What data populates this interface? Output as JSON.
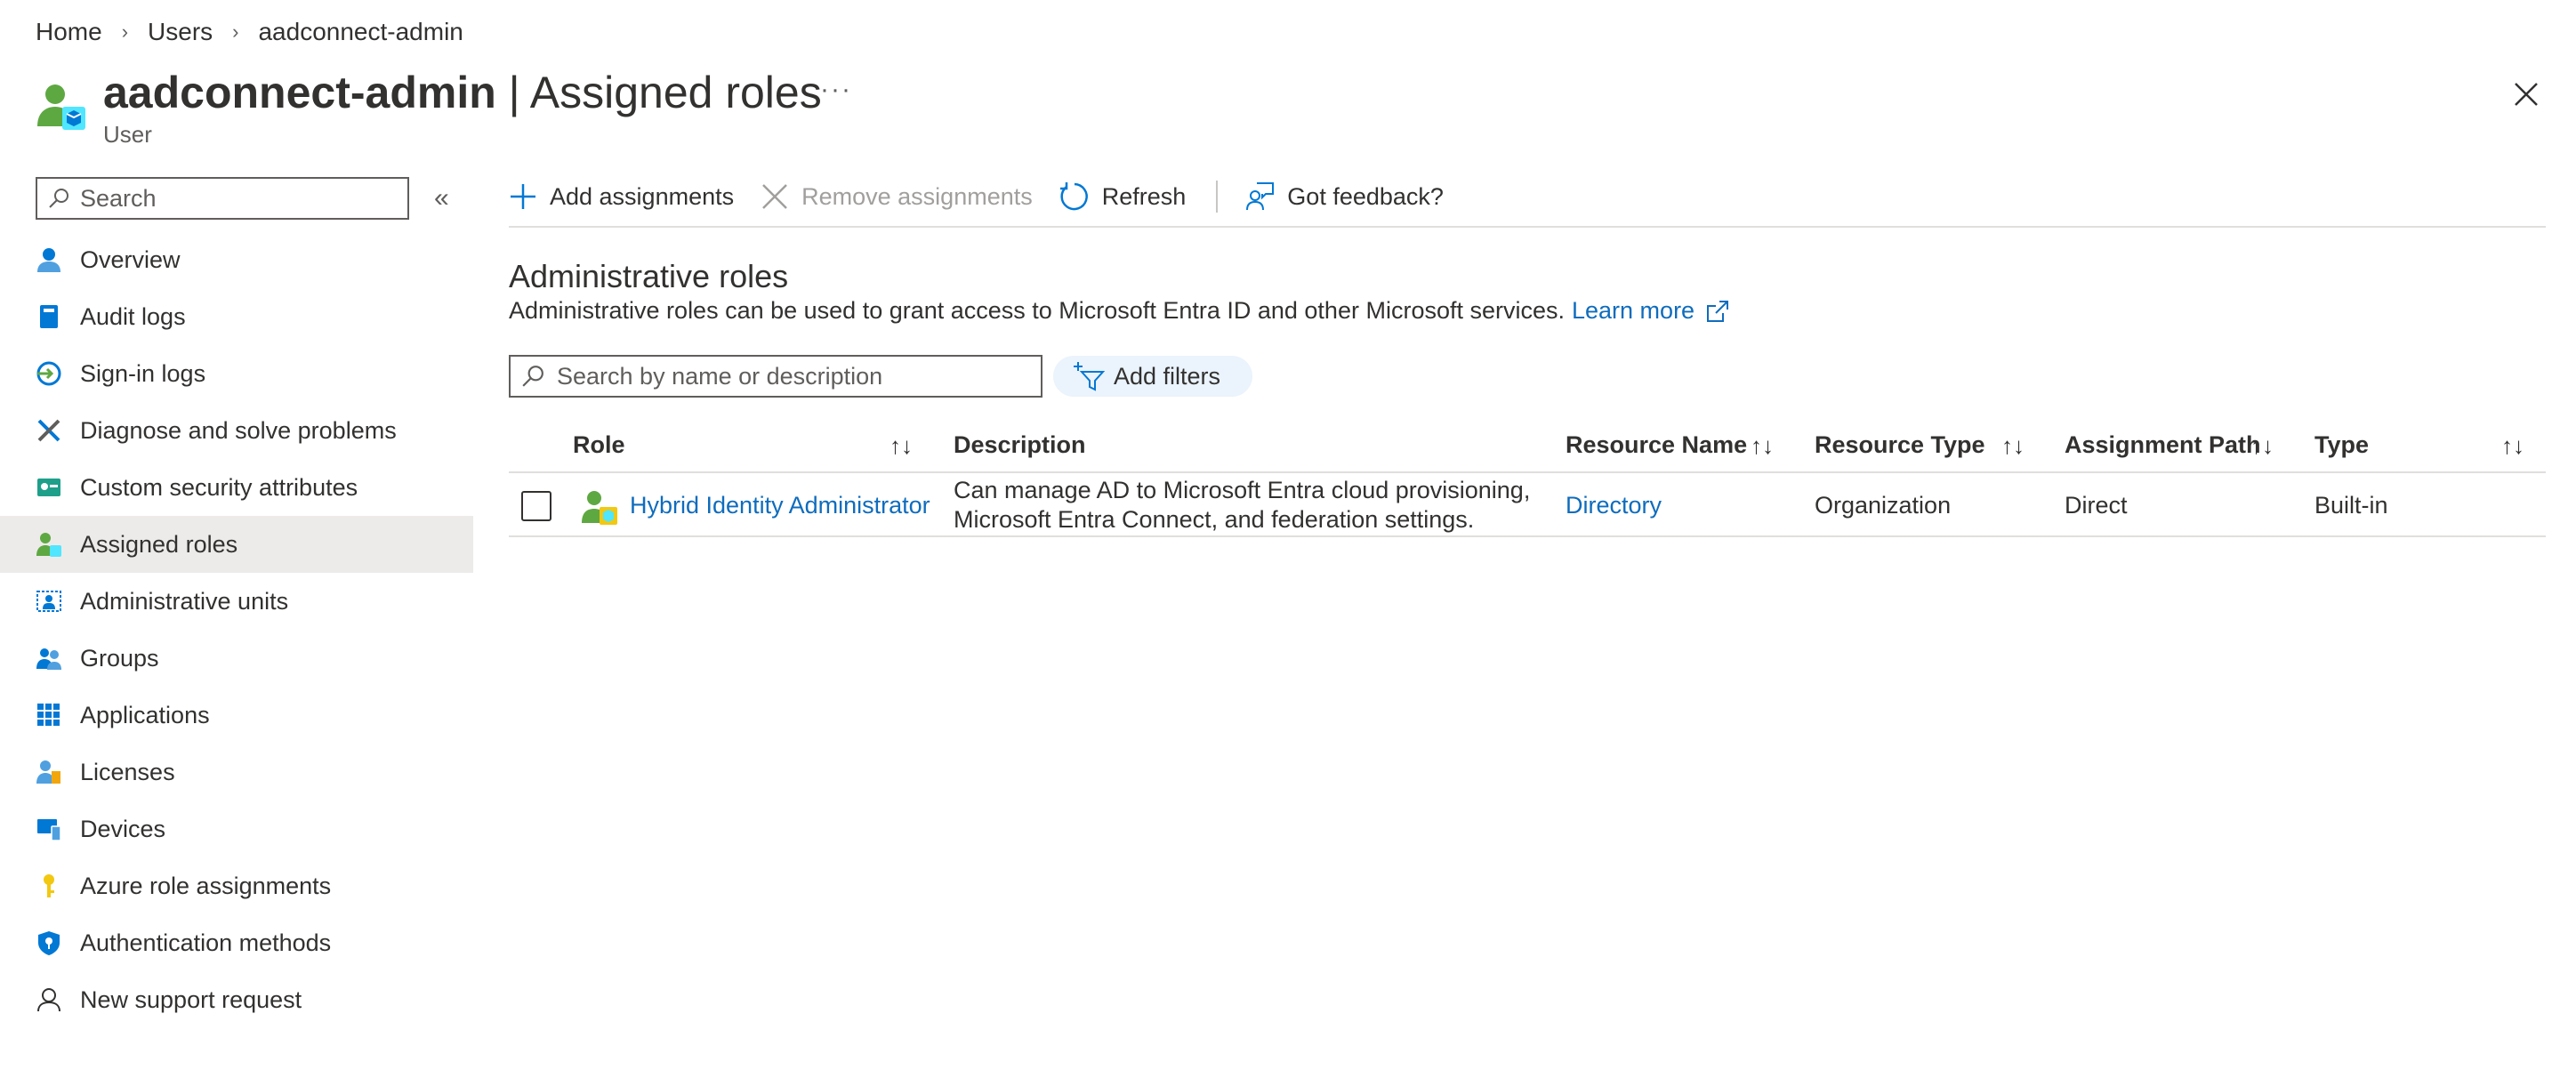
{
  "breadcrumb": [
    {
      "label": "Home"
    },
    {
      "label": "Users"
    },
    {
      "label": "aadconnect-admin"
    }
  ],
  "header": {
    "name": "aadconnect-admin",
    "separator": " | ",
    "page": "Assigned roles",
    "subtitle": "User",
    "more": "···"
  },
  "sidebar": {
    "search_placeholder": "Search",
    "collapse": "«",
    "items": [
      {
        "label": "Overview",
        "icon": "person-icon"
      },
      {
        "label": "Audit logs",
        "icon": "book-icon"
      },
      {
        "label": "Sign-in logs",
        "icon": "sign-in-icon"
      },
      {
        "label": "Diagnose and solve problems",
        "icon": "wrench-icon"
      },
      {
        "label": "Custom security attributes",
        "icon": "attributes-icon"
      },
      {
        "label": "Assigned roles",
        "icon": "roles-icon",
        "active": true
      },
      {
        "label": "Administrative units",
        "icon": "admin-units-icon"
      },
      {
        "label": "Groups",
        "icon": "groups-icon"
      },
      {
        "label": "Applications",
        "icon": "grid-icon"
      },
      {
        "label": "Licenses",
        "icon": "license-icon"
      },
      {
        "label": "Devices",
        "icon": "devices-icon"
      },
      {
        "label": "Azure role assignments",
        "icon": "key-icon"
      },
      {
        "label": "Authentication methods",
        "icon": "shield-icon"
      },
      {
        "label": "New support request",
        "icon": "support-icon"
      }
    ]
  },
  "toolbar": {
    "add": "Add assignments",
    "remove": "Remove assignments",
    "refresh": "Refresh",
    "feedback": "Got feedback?"
  },
  "section": {
    "title": "Administrative roles",
    "description": "Administrative roles can be used to grant access to Microsoft Entra ID and other Microsoft services.",
    "learn_more": "Learn more"
  },
  "filters": {
    "search_placeholder": "Search by name or description",
    "add_filters": "Add filters"
  },
  "table": {
    "columns": [
      "Role",
      "Description",
      "Resource Name",
      "Resource Type",
      "Assignment Path",
      "Type"
    ],
    "sort_glyph": "↑↓",
    "rows": [
      {
        "role": "Hybrid Identity Administrator",
        "description_line1": "Can manage AD to Microsoft Entra cloud provisioning,",
        "description_line2": "Microsoft Entra Connect, and federation settings.",
        "resource_name": "Directory",
        "resource_type": "Organization",
        "assignment_path": "Direct",
        "type": "Built-in"
      }
    ]
  },
  "colors": {
    "link": "#0f6cbd",
    "active_nav": "#edebe9",
    "filter_pill": "#ebf3fc"
  }
}
